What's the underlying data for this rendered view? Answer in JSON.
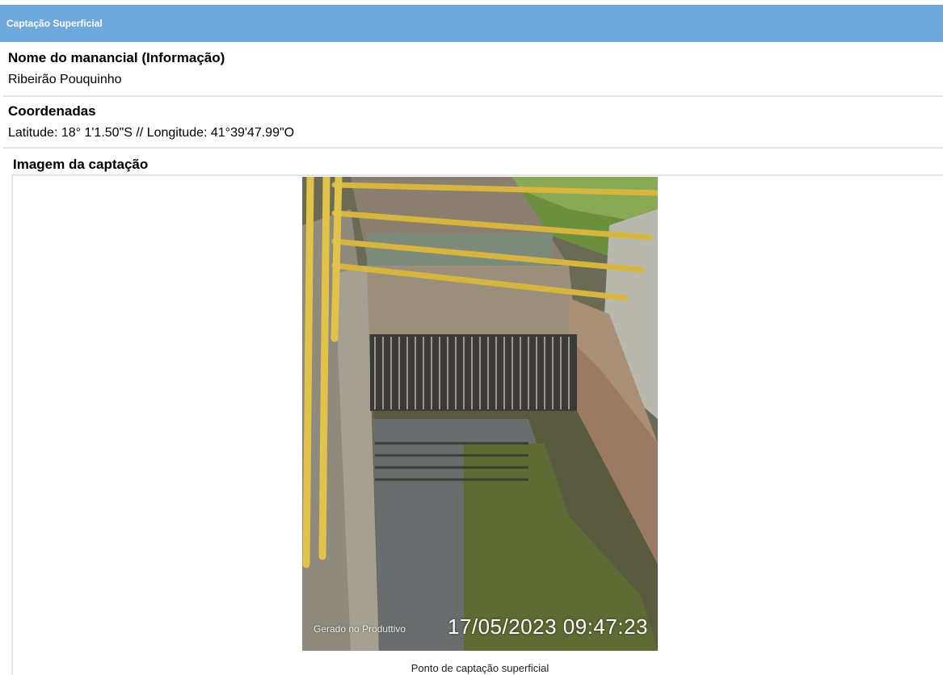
{
  "section": {
    "title": "Captação Superficial",
    "color": "#6fa8dc"
  },
  "fields": {
    "manancial": {
      "label": "Nome do manancial (Informação)",
      "value": "Ribeirão Pouquinho"
    },
    "coordenadas": {
      "label": "Coordenadas",
      "value": "Latitude: 18°  1'1.50\"S // Longitude: 41°39'47.99\"O"
    }
  },
  "image": {
    "label": "Imagem da captação",
    "watermark": "Gerado no Produttivo",
    "timestamp": "17/05/2023 09:47:23",
    "caption": "Ponto de captação superficial"
  }
}
